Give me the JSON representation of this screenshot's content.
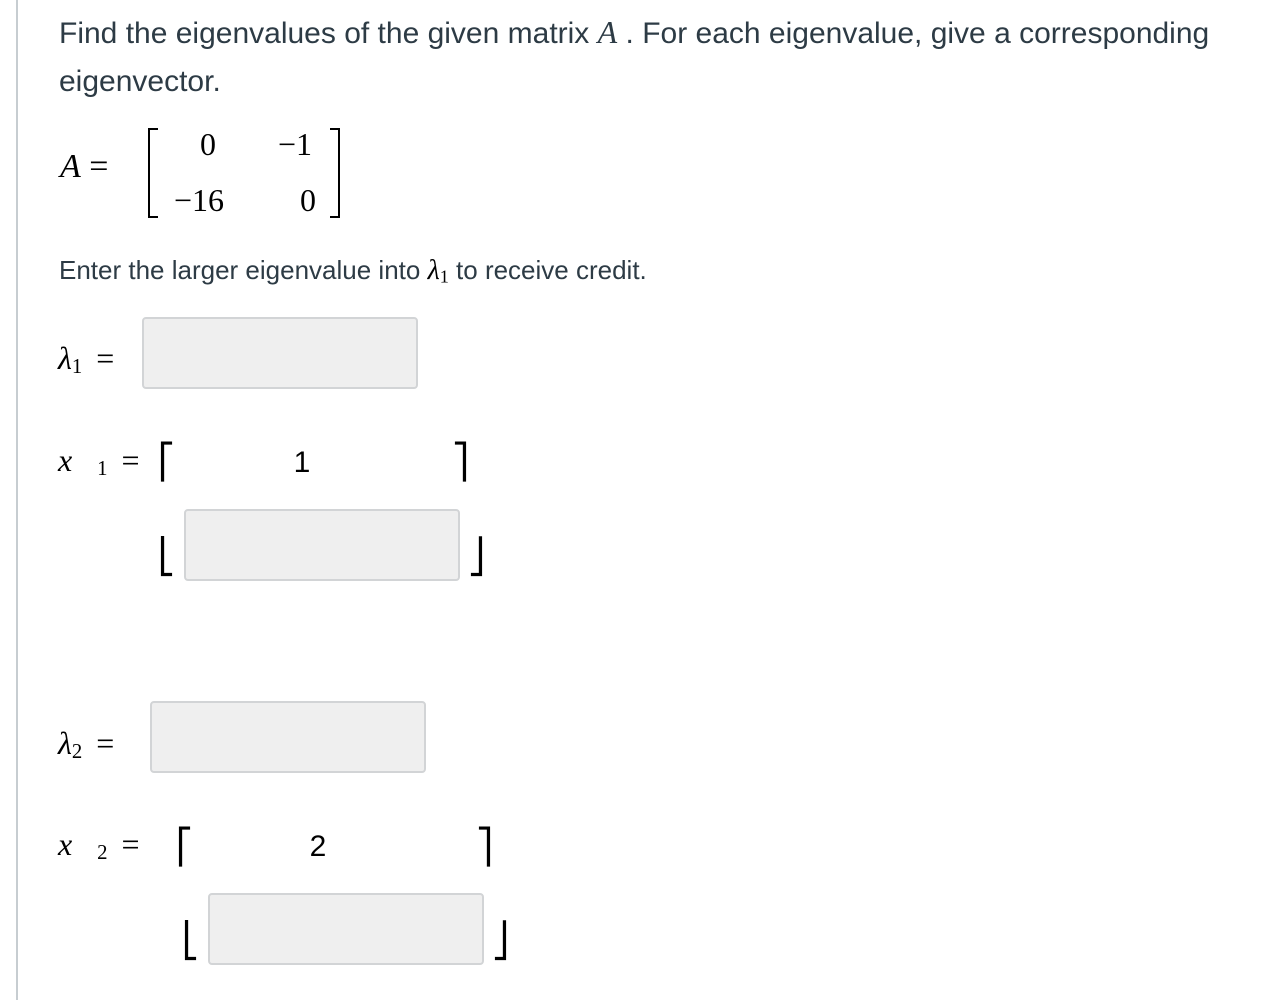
{
  "question": {
    "text_before": "Find the eigenvalues of the given matrix ",
    "matrix_symbol": "A",
    "text_after": " . For each eigenvalue, give a corresponding eigenvector."
  },
  "matrix": {
    "label": "A",
    "equals": "=",
    "rows": [
      [
        "0",
        "−1"
      ],
      [
        "−16",
        "0"
      ]
    ]
  },
  "instruction": {
    "text_before": "Enter the larger eigenvalue into ",
    "lambda": "λ",
    "lambda_sub": "1",
    "text_after": " to receive credit."
  },
  "lambda1": {
    "symbol": "λ",
    "sub": "1",
    "equals": "=",
    "value": ""
  },
  "x1": {
    "symbol": "x⃗",
    "sub": "1",
    "equals": "=",
    "top_bracket_left": "⎡",
    "top_bracket_right": "⎤",
    "bottom_bracket_left": "⎣",
    "bottom_bracket_right": "⎦",
    "first_component": "1",
    "second_component": ""
  },
  "lambda2": {
    "symbol": "λ",
    "sub": "2",
    "equals": "=",
    "value": ""
  },
  "x2": {
    "symbol": "x⃗",
    "sub": "2",
    "equals": "=",
    "top_bracket_left": "⎡",
    "top_bracket_right": "⎤",
    "bottom_bracket_left": "⎣",
    "bottom_bracket_right": "⎦",
    "first_component": "2",
    "second_component": ""
  }
}
